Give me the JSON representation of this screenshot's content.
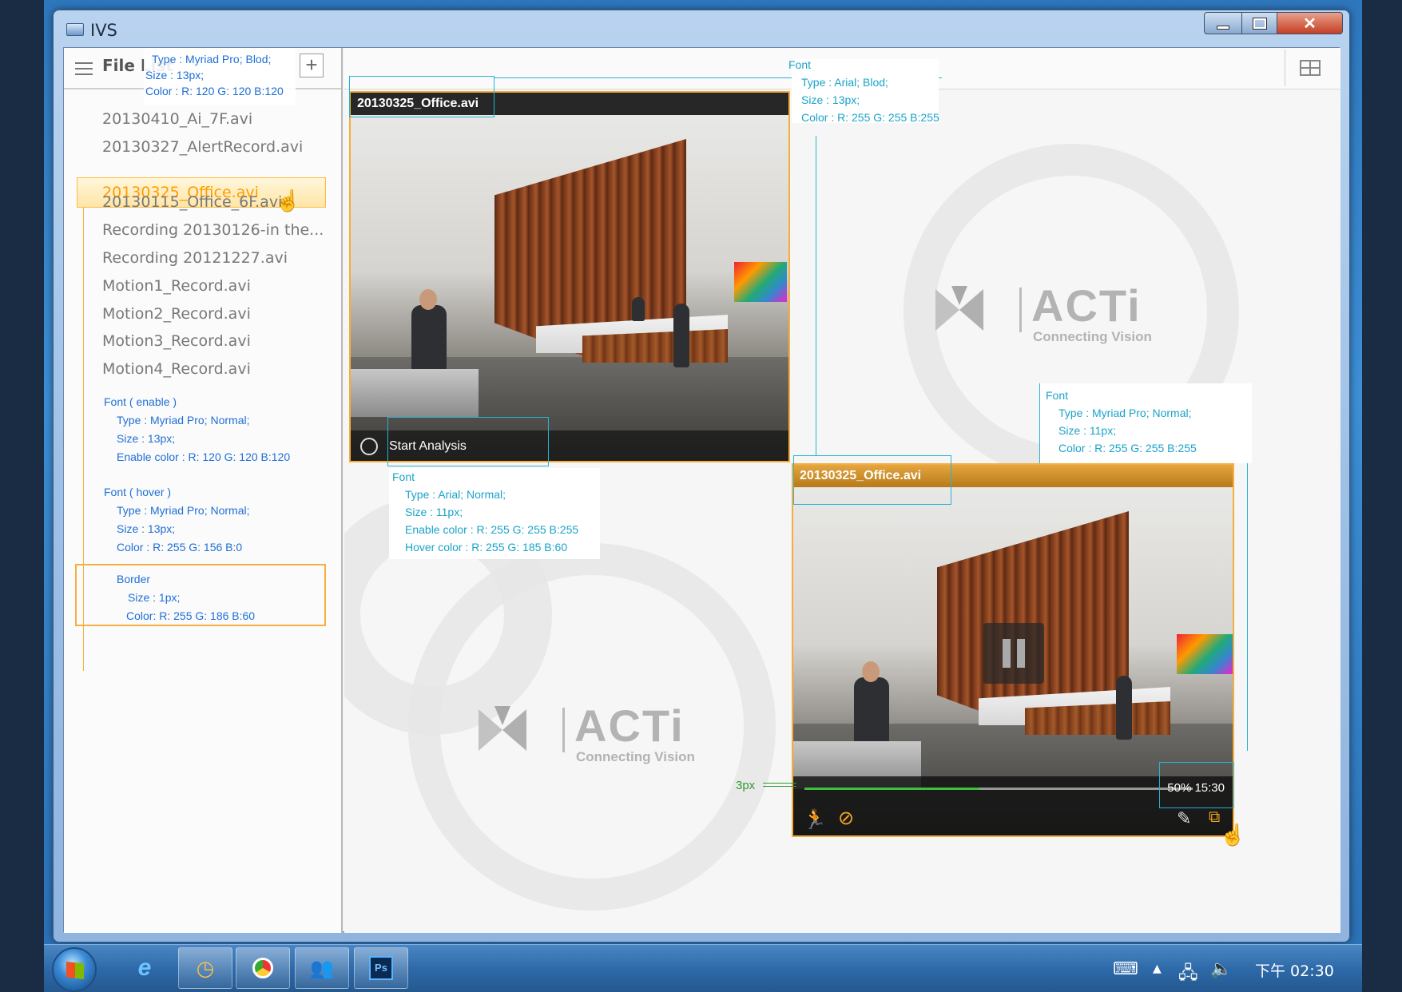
{
  "window": {
    "title": "IVS"
  },
  "sidebar": {
    "title": "File List",
    "add_label": "+",
    "files": [
      "20130410_Ai_7F.avi",
      "20130327_AlertRecord.avi",
      "20130325_Office.avi",
      "20130115_Office_6F.avi",
      "Recording 20130126-in the...",
      "Recording 20121227.avi",
      "Motion1_Record.avi",
      "Motion2_Record.avi",
      "Motion3_Record.avi",
      "Motion4_Record.avi"
    ],
    "selected_index": 2
  },
  "annotations": {
    "header_font": {
      "type": "Type : Myriad Pro;     Blod;",
      "size": "Size : 13px;",
      "color": "Color : R: 120 G: 120 B:120"
    },
    "font_enable": {
      "title": "Font ( enable )",
      "type": "Type : Myriad Pro;     Normal;",
      "size": "Size : 13px;",
      "color": "Enable color : R: 120 G: 120 B:120"
    },
    "font_hover": {
      "title": "Font ( hover )",
      "type": "Type : Myriad Pro;     Normal;",
      "size": "Size : 13px;",
      "color": "Color : R: 255 G: 156 B:0"
    },
    "border": {
      "title": "Border",
      "size": "Size : 1px;",
      "color": "Color:  R: 255 G: 186 B:60"
    },
    "video_title_font": {
      "title": "Font",
      "type": "Type : Arial;     Blod;",
      "size": "Size : 13px;",
      "color": "Color : R: 255 G: 255 B:255"
    },
    "analysis_font": {
      "title": "Font",
      "type": "Type : Arial;     Normal;",
      "size": "Size : 11px;",
      "enable": "Enable color : R: 255 G: 255 B:255",
      "hover": "Hover color : R: 255 G: 185 B:60"
    },
    "time_font": {
      "title": "Font",
      "type": "Type : Myriad Pro;     Normal;",
      "size": "Size : 11px;",
      "color": "Color : R: 255 G: 255 B:255"
    },
    "progress_thickness": "3px"
  },
  "video1": {
    "title": "20130325_Office.avi",
    "action_label": "Start Analysis"
  },
  "video2": {
    "title": "20130325_Office.avi",
    "progress_percent": 45,
    "time_label": "50% 15:30"
  },
  "logo": {
    "brand": "ACTi",
    "tagline": "Connecting Vision"
  },
  "taskbar": {
    "clock": "下午 02:30"
  },
  "colors": {
    "accent_orange": "#ffba3c",
    "hover_orange": "#ff9c00",
    "progress_green": "#3ec13e",
    "annotation_blue": "#1f6fd6",
    "annotation_cyan": "#1aa3c8"
  }
}
